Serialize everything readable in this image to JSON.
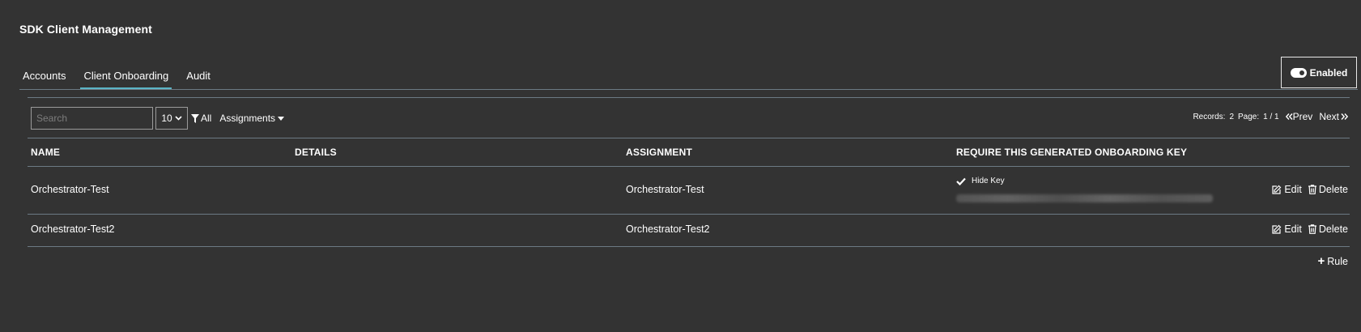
{
  "page": {
    "title": "SDK Client Management"
  },
  "tabs": [
    {
      "label": "Accounts",
      "active": false
    },
    {
      "label": "Client Onboarding",
      "active": true
    },
    {
      "label": "Audit",
      "active": false
    }
  ],
  "status_toggle": {
    "label": "Enabled",
    "on": true
  },
  "toolbar": {
    "search_placeholder": "Search",
    "page_size": "10",
    "filter_label": "All",
    "assignments_label": "Assignments"
  },
  "pager": {
    "records_label": "Records:",
    "records_count": "2",
    "page_label": "Page:",
    "page_value": "1 / 1",
    "prev_label": "Prev",
    "next_label": "Next"
  },
  "table": {
    "headers": [
      "NAME",
      "DETAILS",
      "ASSIGNMENT",
      "REQUIRE THIS GENERATED ONBOARDING KEY"
    ],
    "rows": [
      {
        "name": "Orchestrator-Test",
        "details": "",
        "assignment": "Orchestrator-Test",
        "key_toggle_label": "Hide Key"
      },
      {
        "name": "Orchestrator-Test2",
        "details": "",
        "assignment": "Orchestrator-Test2",
        "key_toggle_label": ""
      }
    ],
    "edit_label": "Edit",
    "delete_label": "Delete"
  },
  "add_rule_label": "Rule",
  "colors": {
    "background": "#333333",
    "accent": "#5bb5c6",
    "divider": "#6c7a84"
  },
  "icons": [
    "toggle-on-icon",
    "chevron-down-icon",
    "filter-icon",
    "caret-down-icon",
    "double-chevron-left-icon",
    "double-chevron-right-icon",
    "checkmark-icon",
    "edit-icon",
    "trash-icon",
    "plus-icon"
  ]
}
